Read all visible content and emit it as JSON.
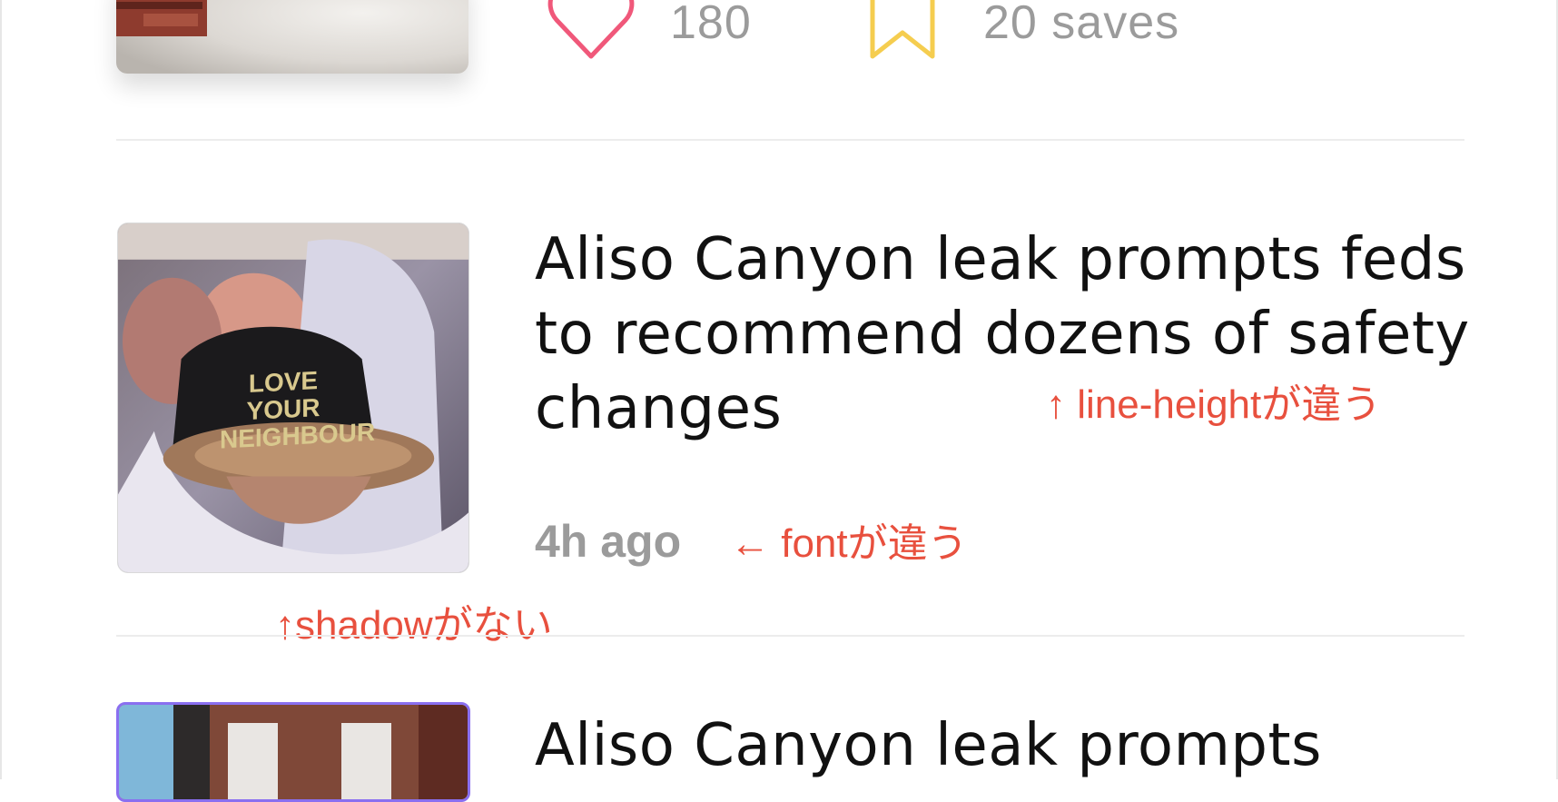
{
  "feed": {
    "items": [
      {
        "stats": {
          "likes": "180",
          "saves": "20 saves"
        }
      },
      {
        "title": "Aliso Canyon leak prompts feds to recommend dozens of safety changes",
        "time": "4h ago",
        "thumbnail_cap_text": "LOVE YOUR NEIGHBOUR"
      },
      {
        "title": "Aliso Canyon leak prompts"
      }
    ]
  },
  "annotations": {
    "line_height": "↑ line-heightが違う",
    "font": "← fontが違う",
    "shadow": "↑shadowがない"
  },
  "icons": {
    "like": "heart-outline-icon",
    "save": "bookmark-outline-icon"
  },
  "colors": {
    "heart": "#f0587a",
    "bookmark": "#f5cd4f",
    "annotation": "#e8503e",
    "muted_text": "#9b9b9b",
    "selection": "#8a6ff0"
  }
}
